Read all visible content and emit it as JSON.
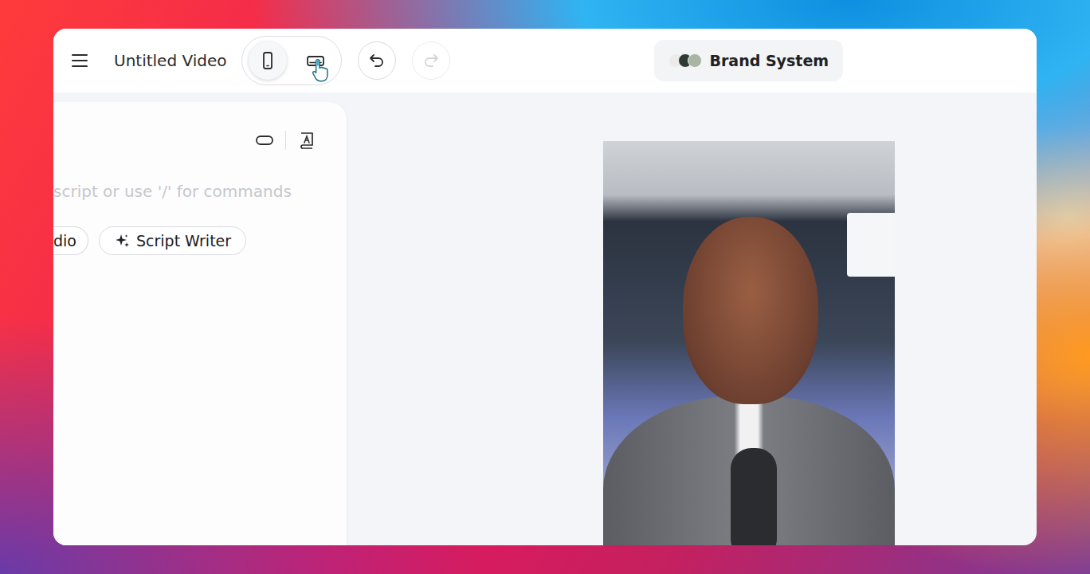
{
  "window": {
    "title": "Untitled Video"
  },
  "view_toggle": [
    {
      "kind": "portrait",
      "selected": true,
      "hovered": false
    },
    {
      "kind": "landscape",
      "selected": false,
      "hovered": true
    }
  ],
  "history": {
    "undo": {
      "disabled": false
    },
    "redo": {
      "disabled": true
    }
  },
  "brand": {
    "label": "Brand System",
    "swatches": [
      {
        "color": "#ecebea"
      },
      {
        "color": "#2e3a33"
      },
      {
        "color": "#a9b5a0"
      }
    ]
  },
  "editor": {
    "placeholder": "script or use '/' for commands",
    "chips": [
      {
        "label": "dio",
        "kind": "plain"
      },
      {
        "label": "Script Writer",
        "kind": "ai"
      }
    ]
  }
}
